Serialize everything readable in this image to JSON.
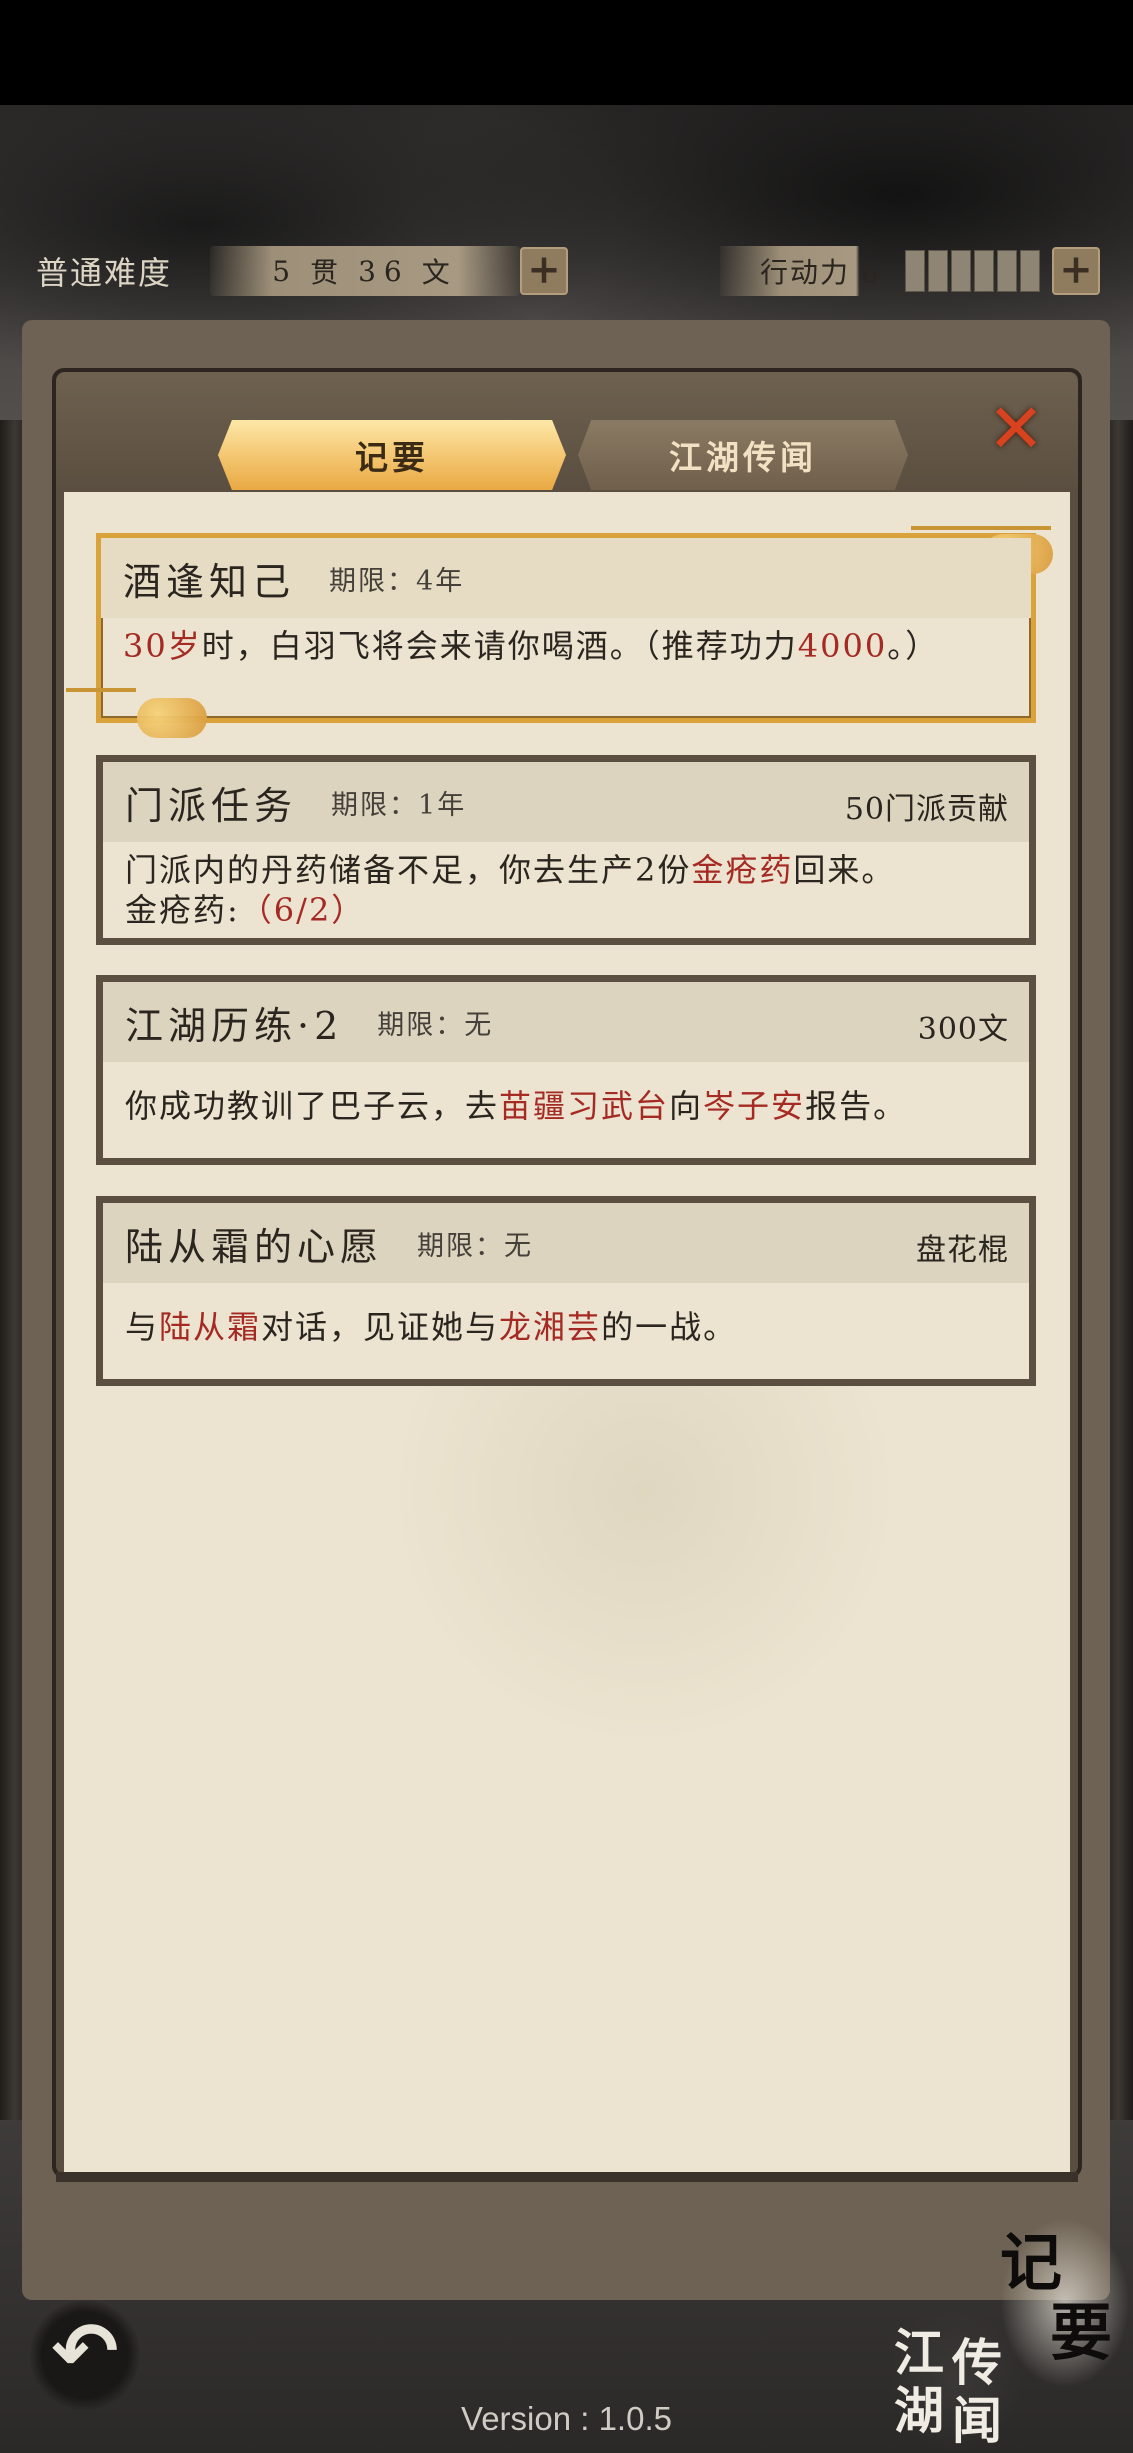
{
  "status": {
    "difficulty": "普通难度",
    "money_guan": "5",
    "money_guan_unit": "贯",
    "money_wen": "36",
    "money_wen_unit": "文",
    "plus_icon": "plus-icon",
    "action_points_label": "行动力 6",
    "action_points_value": 6
  },
  "tabs": [
    {
      "label": "记要",
      "active": true
    },
    {
      "label": "江湖传闻",
      "active": false
    }
  ],
  "quests": [
    {
      "title": "酒逢知己",
      "limit": "期限：4年",
      "reward": "",
      "body_parts": [
        "30岁",
        "时，白羽飞将会来请你喝酒。（推荐功力",
        "4000",
        "。）"
      ]
    },
    {
      "title": "门派任务",
      "limit": "期限：1年",
      "reward": "50门派贡献",
      "body_parts": [
        "门派内的丹药储备不足，你去生产2份",
        "金疮药",
        "回来。"
      ],
      "progress_label": "金疮药:",
      "progress_value": "（6/2）"
    },
    {
      "title": "江湖历练·2",
      "limit": "期限：无",
      "reward": "300文",
      "body_parts": [
        "你成功教训了巴子云，去",
        "苗疆习武台",
        "向",
        "岑子安",
        "报告。"
      ]
    },
    {
      "title": "陆从霜的心愿",
      "limit": "期限：无",
      "reward": "盘花棍",
      "body_parts": [
        "与",
        "陆从霜",
        "对话，见证她与",
        "龙湘芸",
        "的一战。"
      ]
    }
  ],
  "bottom": {
    "jiyao_char1": "记",
    "jiyao_char2": "要",
    "jianghu_char1": "江",
    "jianghu_char2": "传",
    "jianghu_char3": "湖",
    "jianghu_char4": "闻",
    "version": "Version : 1.0.5"
  },
  "colors": {
    "highlight_red": "#a52a23",
    "tab_active": "#f3c46e",
    "close_red": "#d9421f"
  }
}
